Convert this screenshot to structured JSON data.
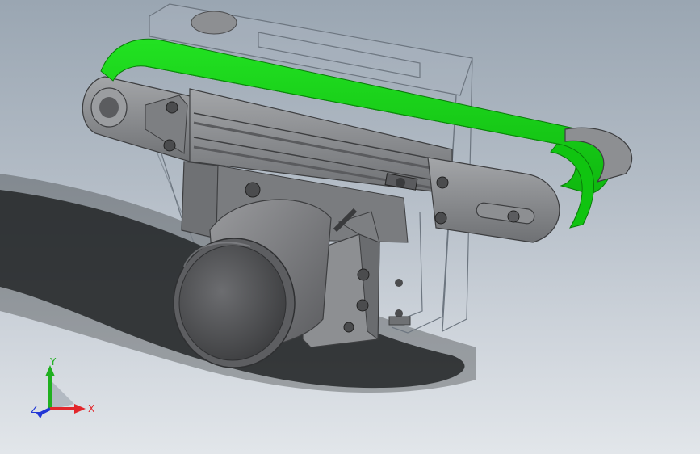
{
  "viewport": {
    "background_top": "#9aa6b2",
    "background_bottom": "#e2e6ea"
  },
  "model": {
    "belt_color": "#17d017",
    "frame_color": "#8e8f92",
    "frame_dark": "#4a4b4d",
    "motor_color": "#7f8083",
    "housing_color": "#b7bfc8"
  },
  "triad": {
    "x_label": "X",
    "y_label": "Y",
    "z_label": "Z",
    "x_color": "#e2262b",
    "y_color": "#1fb01f",
    "z_color": "#2236d6"
  }
}
